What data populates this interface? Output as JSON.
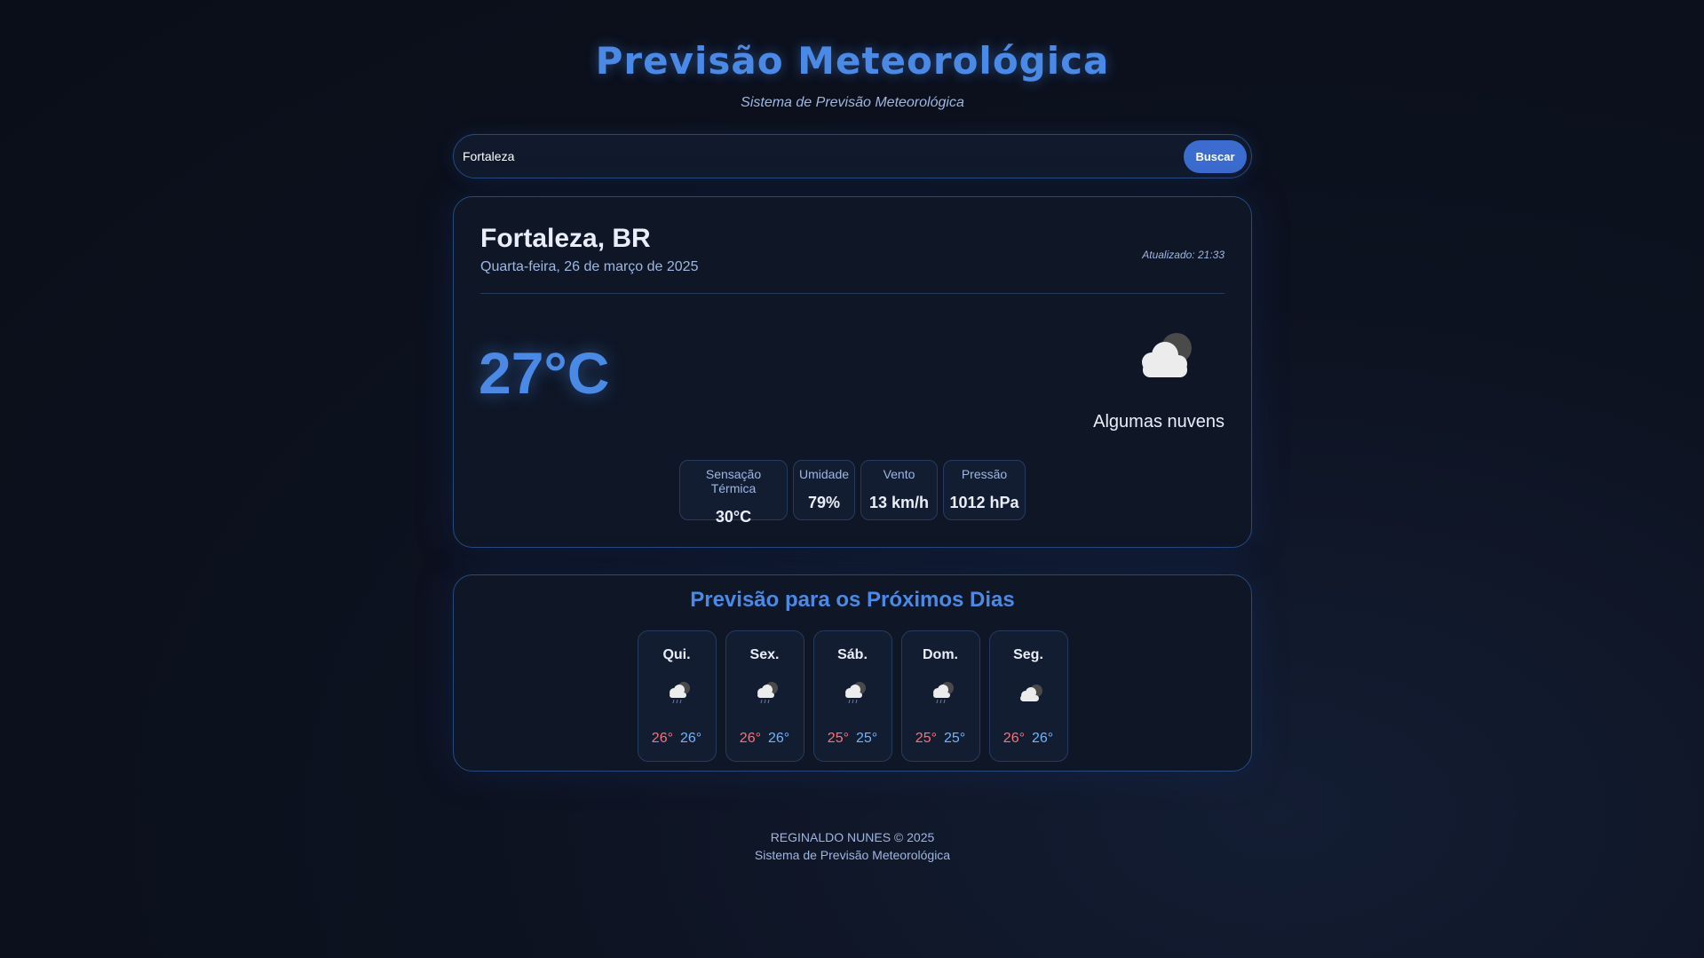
{
  "header": {
    "title": "Previsão Meteorológica",
    "subtitle": "Sistema de Previsão Meteorológica"
  },
  "search": {
    "value": "Fortaleza",
    "button_label": "Buscar"
  },
  "current": {
    "city": "Fortaleza, BR",
    "date": "Quarta-feira, 26 de março de 2025",
    "updated": "Atualizado: 21:33",
    "temperature": "27°C",
    "description": "Algumas nuvens",
    "icon": "cloud-night-icon",
    "details": [
      {
        "label": "Sensação Térmica",
        "value": "30°C"
      },
      {
        "label": "Umidade",
        "value": "79%"
      },
      {
        "label": "Vento",
        "value": "13 km/h"
      },
      {
        "label": "Pressão",
        "value": "1012 hPa"
      }
    ]
  },
  "forecast": {
    "title": "Previsão para os Próximos Dias",
    "days": [
      {
        "day": "Qui.",
        "icon": "rain-night-icon",
        "max": "26°",
        "min": "26°"
      },
      {
        "day": "Sex.",
        "icon": "rain-night-icon",
        "max": "26°",
        "min": "26°"
      },
      {
        "day": "Sáb.",
        "icon": "rain-night-icon",
        "max": "25°",
        "min": "25°"
      },
      {
        "day": "Dom.",
        "icon": "rain-night-icon",
        "max": "25°",
        "min": "25°"
      },
      {
        "day": "Seg.",
        "icon": "cloud-night-icon",
        "max": "26°",
        "min": "26°"
      }
    ]
  },
  "footer": {
    "line1": "REGINALDO NUNES © 2025",
    "line2": "Sistema de Previsão Meteorológica"
  },
  "colors": {
    "accent": "#4a8ae6",
    "button": "#3b6cd0",
    "max_temp": "#ff6f73",
    "min_temp": "#6fb4ff",
    "background": "#0a0e18"
  }
}
